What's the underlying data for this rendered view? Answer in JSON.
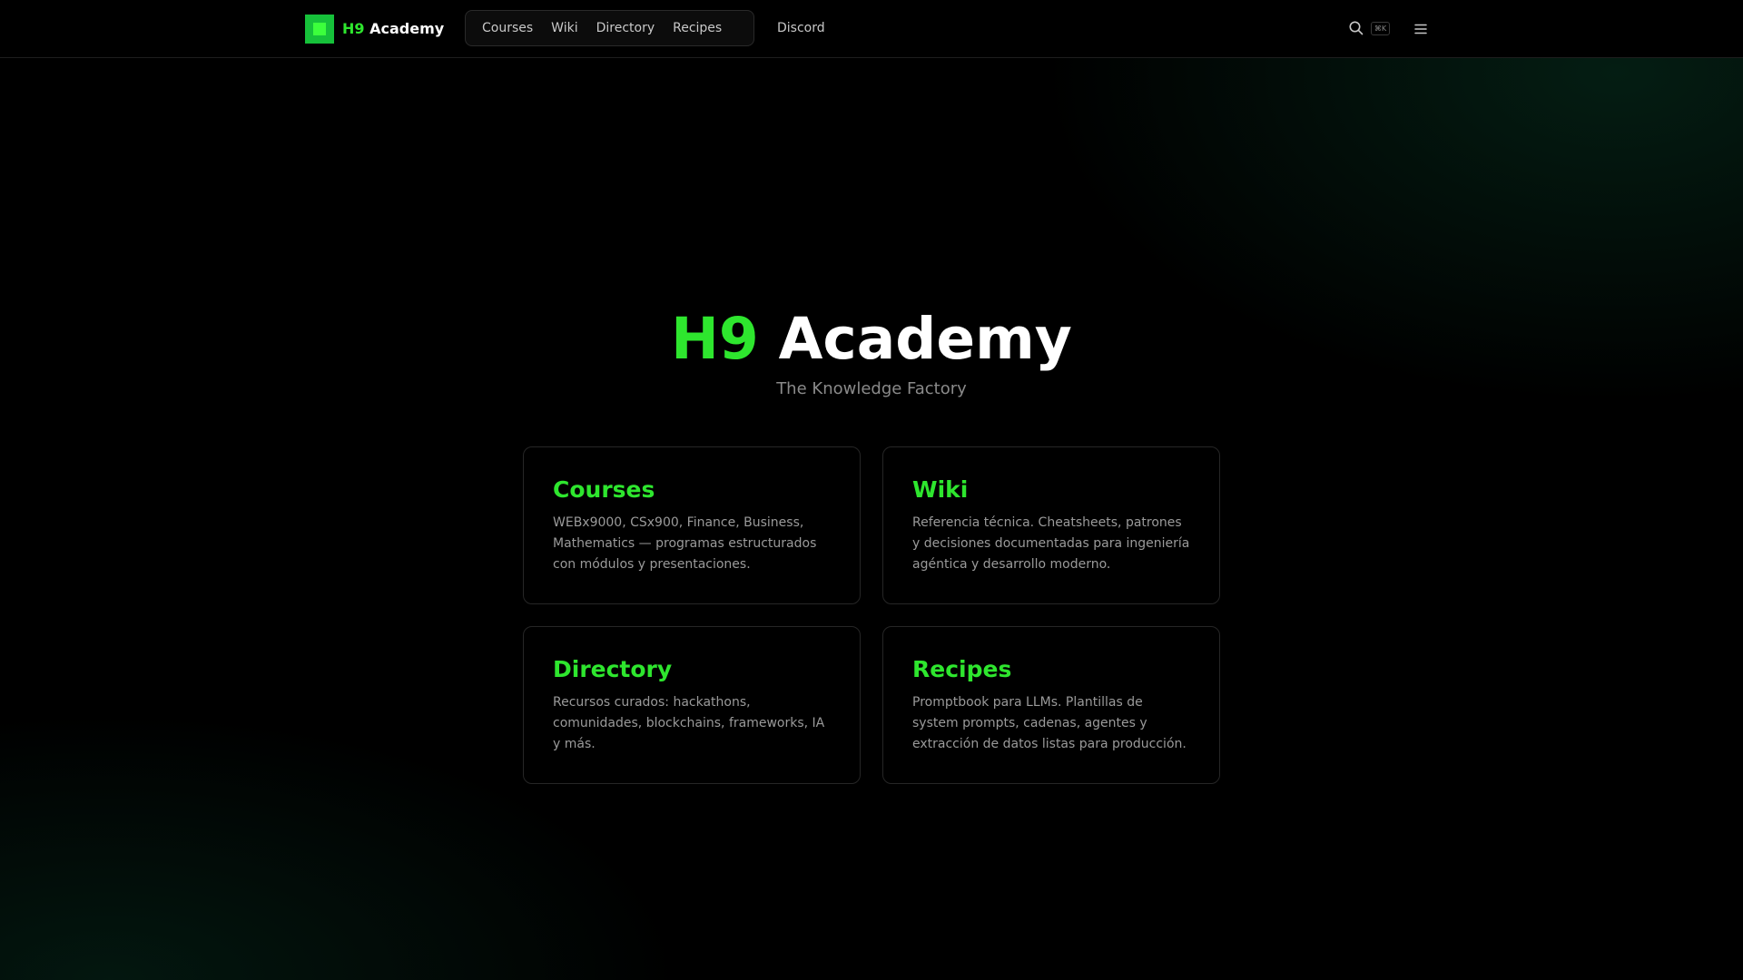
{
  "header": {
    "logo": {
      "accent": "H9",
      "rest": " Academy"
    },
    "nav": [
      {
        "label": "Courses"
      },
      {
        "label": "Wiki"
      },
      {
        "label": "Directory"
      },
      {
        "label": "Recipes"
      }
    ],
    "discord_label": "Discord",
    "search_shortcut": "⌘K",
    "search_icon": "search-icon",
    "menu_icon": "menu-icon"
  },
  "hero": {
    "title_accent": "H9",
    "title_rest": " Academy",
    "subtitle": "The Knowledge Factory"
  },
  "cards": [
    {
      "title": "Courses",
      "description": "WEBx9000, CSx900, Finance, Business, Mathematics — programas estructurados con módulos y presentaciones."
    },
    {
      "title": "Wiki",
      "description": "Referencia técnica. Cheatsheets, patrones y decisiones documentadas para ingeniería agéntica y desarrollo moderno."
    },
    {
      "title": "Directory",
      "description": "Recursos curados: hackathons, comunidades, blockchains, frameworks, IA y más."
    },
    {
      "title": "Recipes",
      "description": "Promptbook para LLMs. Plantillas de system prompts, cadenas, agentes y extracción de datos listas para producción."
    }
  ],
  "colors": {
    "accent": "#2ee62e",
    "background": "#000000",
    "muted_text": "#9a9a9a"
  }
}
